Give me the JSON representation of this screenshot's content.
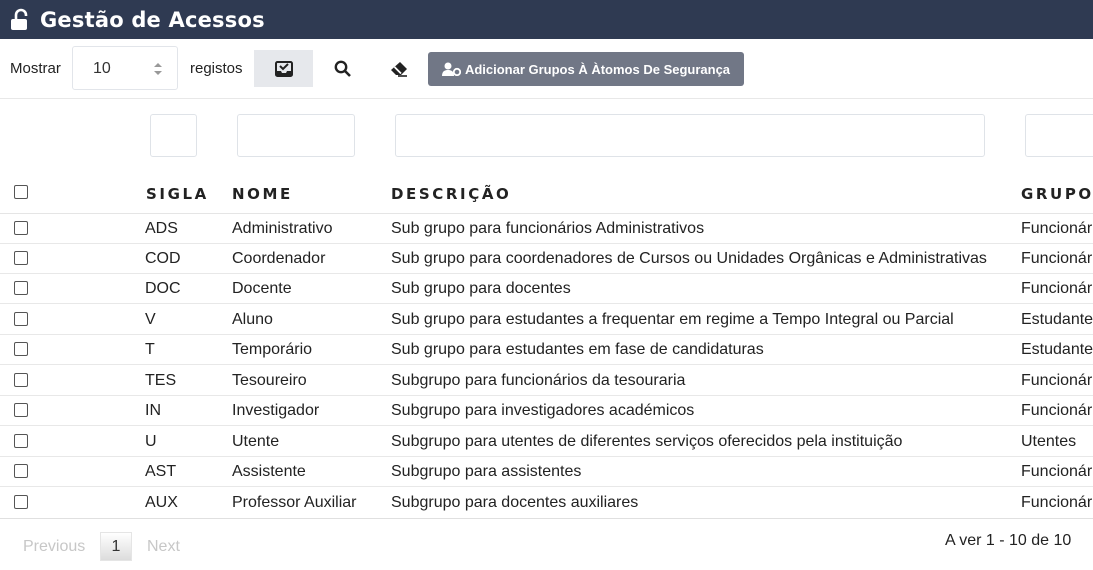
{
  "app": {
    "title": "Gestão de Acessos"
  },
  "toolbar": {
    "show_label": "Mostrar",
    "page_length": "10",
    "records_label": "registos",
    "add_label": "Adicionar Grupos À Àtomos De Segurança"
  },
  "table": {
    "headers": {
      "sigla": "SIGLA",
      "nome": "NOME",
      "descricao": "DESCRIÇÃO",
      "grupo": "GRUPO"
    },
    "rows": [
      {
        "sigla": "ADS",
        "nome": "Administrativo",
        "descricao": "Sub grupo para funcionários Administrativos",
        "grupo": "Funcionár"
      },
      {
        "sigla": "COD",
        "nome": "Coordenador",
        "descricao": "Sub grupo para coordenadores de Cursos ou Unidades Orgânicas e Administrativas",
        "grupo": "Funcionár"
      },
      {
        "sigla": "DOC",
        "nome": "Docente",
        "descricao": "Sub grupo para docentes",
        "grupo": "Funcionár"
      },
      {
        "sigla": "V",
        "nome": "Aluno",
        "descricao": "Sub grupo para estudantes a frequentar em regime a Tempo Integral ou Parcial",
        "grupo": "Estudante"
      },
      {
        "sigla": "T",
        "nome": "Temporário",
        "descricao": "Sub grupo para estudantes em fase de candidaturas",
        "grupo": "Estudante"
      },
      {
        "sigla": "TES",
        "nome": "Tesoureiro",
        "descricao": "Subgrupo para funcionários da tesouraria",
        "grupo": "Funcionár"
      },
      {
        "sigla": "IN",
        "nome": "Investigador",
        "descricao": "Subgrupo para investigadores académicos",
        "grupo": "Funcionár"
      },
      {
        "sigla": "U",
        "nome": "Utente",
        "descricao": "Subgrupo para utentes de diferentes serviços oferecidos pela instituição",
        "grupo": "Utentes"
      },
      {
        "sigla": "AST",
        "nome": "Assistente",
        "descricao": "Subgrupo para assistentes",
        "grupo": "Funcionár"
      },
      {
        "sigla": "AUX",
        "nome": "Professor Auxiliar",
        "descricao": "Subgrupo para docentes auxiliares",
        "grupo": "Funcionár"
      }
    ]
  },
  "pagination": {
    "previous": "Previous",
    "current": "1",
    "next": "Next",
    "info": "A ver 1 - 10 de 10"
  },
  "colors": {
    "header_bg": "#2f3a52",
    "add_button_bg": "#717786"
  },
  "icons": {
    "title": "unlock-icon",
    "export": "inbox-check-icon",
    "search": "search-icon",
    "clear": "eraser-icon",
    "add": "user-cog-icon"
  }
}
